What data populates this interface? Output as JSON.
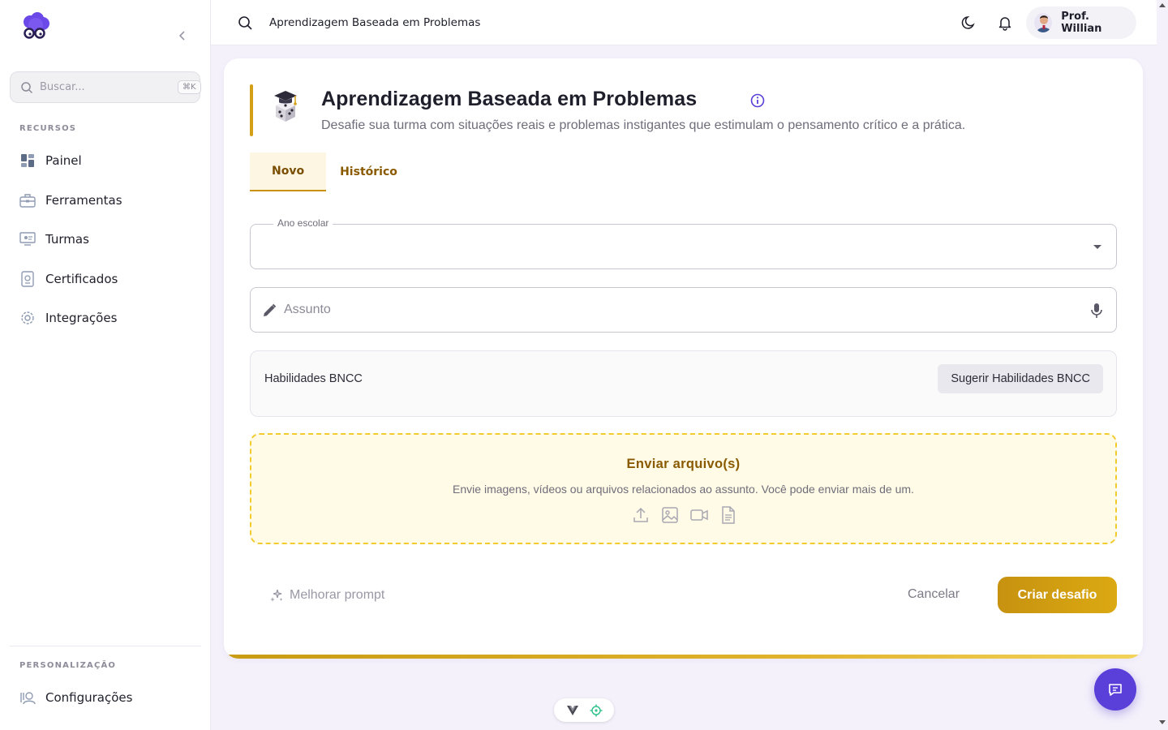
{
  "sidebar": {
    "search_placeholder": "Buscar...",
    "shortcut": "⌘K",
    "section_resources": "RECURSOS",
    "items": [
      {
        "label": "Painel",
        "icon": "dashboard-icon"
      },
      {
        "label": "Ferramentas",
        "icon": "toolbox-icon"
      },
      {
        "label": "Turmas",
        "icon": "classroom-icon"
      },
      {
        "label": "Certificados",
        "icon": "certificate-icon"
      },
      {
        "label": "Integrações",
        "icon": "gear-icon"
      }
    ],
    "section_personalization": "PERSONALIZAÇÃO",
    "settings_label": "Configurações"
  },
  "topbar": {
    "search_value": "Aprendizagem Baseada em Problemas",
    "user_name": "Prof. Willian"
  },
  "page": {
    "title": "Aprendizagem Baseada em Problemas",
    "subtitle": "Desafie sua turma com situações reais e problemas instigantes que estimulam o pensamento crítico e a prática.",
    "tabs": [
      {
        "label": "Novo",
        "active": true
      },
      {
        "label": "Histórico",
        "active": false
      }
    ]
  },
  "form": {
    "grade_label": "Ano escolar",
    "grade_value": "",
    "subject_placeholder": "Assunto",
    "bncc_label": "Habilidades BNCC",
    "bncc_button": "Sugerir Habilidades BNCC",
    "upload_title": "Enviar arquivo(s)",
    "upload_desc": "Envie imagens, vídeos ou arquivos relacionados ao assunto. Você pode enviar mais de um.",
    "improve_prompt": "Melhorar prompt",
    "cancel": "Cancelar",
    "submit": "Criar desafio"
  },
  "colors": {
    "accent": "#d4a017",
    "primary": "#5b3fd9",
    "upload_bg": "#fffbe6",
    "upload_border": "#f2cb2e"
  }
}
